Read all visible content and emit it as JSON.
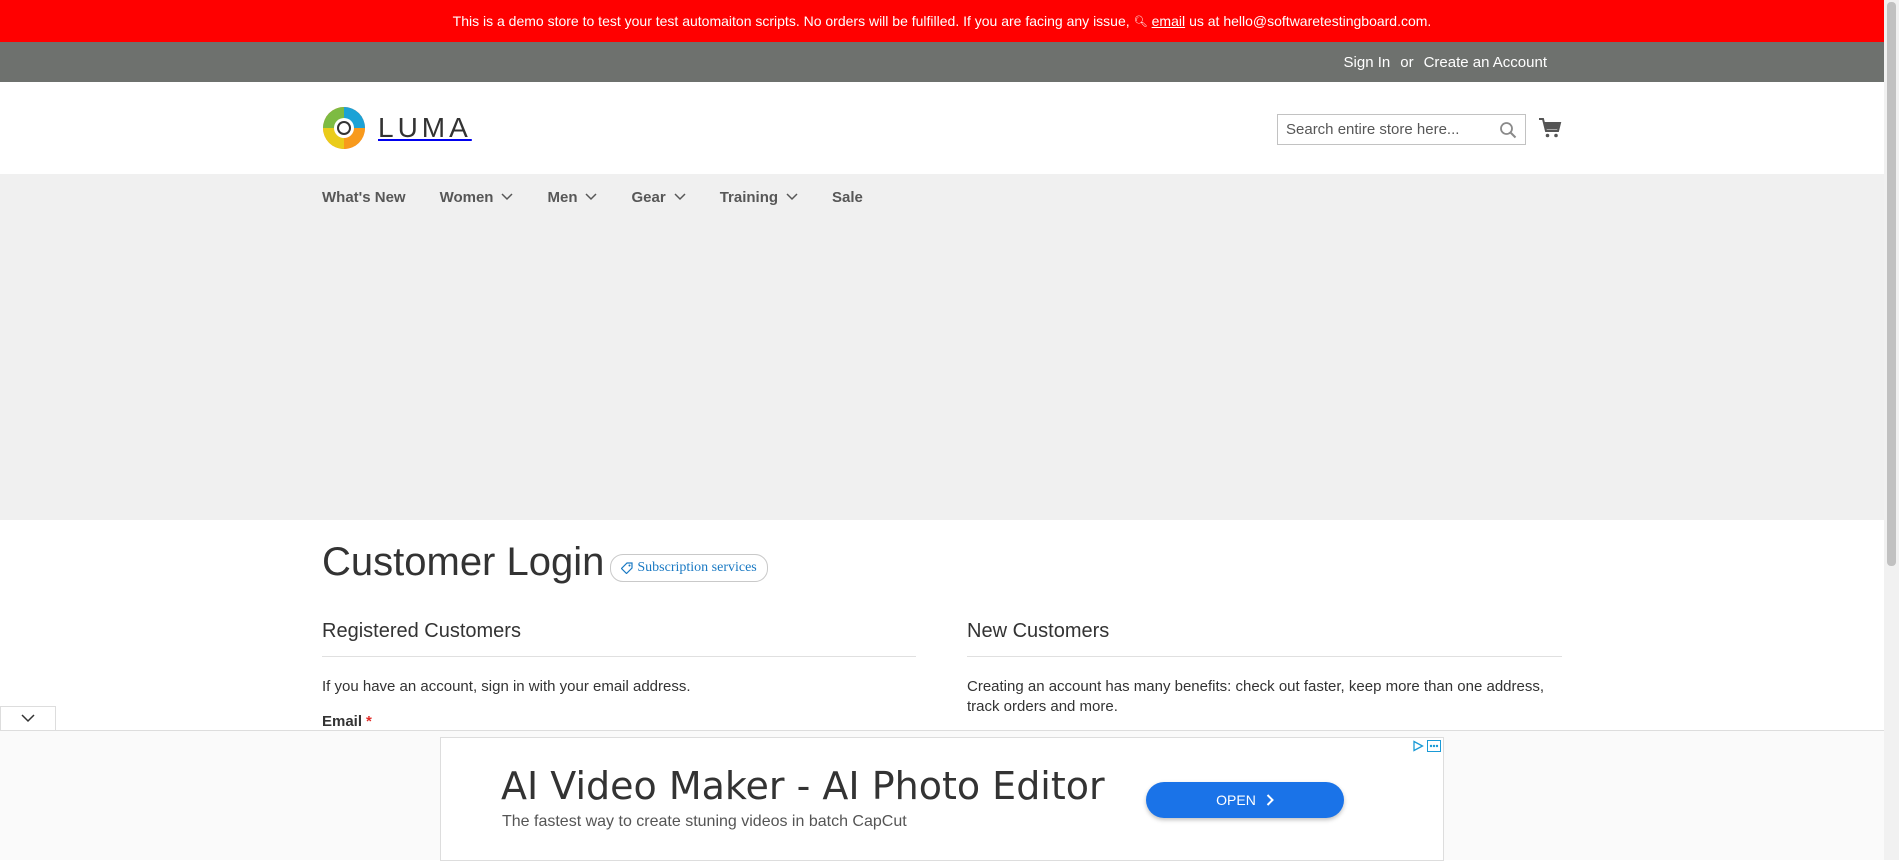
{
  "demo_banner": {
    "text_before": "This is a demo store to test your test automaiton scripts. No orders will be fulfilled. If you are facing any issue,",
    "email_link": "email",
    "text_after": "us at hello@softwaretestingboard.com."
  },
  "top_links": {
    "sign_in": "Sign In",
    "or": "or",
    "create_account": "Create an Account"
  },
  "header": {
    "logo_text": "LUMA",
    "search_placeholder": "Search entire store here..."
  },
  "nav": {
    "items": [
      {
        "label": "What's New",
        "dropdown": false
      },
      {
        "label": "Women",
        "dropdown": true
      },
      {
        "label": "Men",
        "dropdown": true
      },
      {
        "label": "Gear",
        "dropdown": true
      },
      {
        "label": "Training",
        "dropdown": true
      },
      {
        "label": "Sale",
        "dropdown": false
      }
    ]
  },
  "page": {
    "title": "Customer Login",
    "subscription_badge": "Subscription services"
  },
  "registered": {
    "heading": "Registered Customers",
    "text": "If you have an account, sign in with your email address.",
    "email_label": "Email",
    "required_mark": "*"
  },
  "new_customers": {
    "heading": "New Customers",
    "text": "Creating an account has many benefits: check out faster, keep more than one address, track orders and more."
  },
  "ad": {
    "title": "AI Video Maker - AI Photo Editor",
    "subtitle": "The fastest way to create stuning videos in batch CapCut",
    "button": "OPEN"
  },
  "colors": {
    "banner": "#ff0000",
    "top_bar": "#6e716e",
    "nav_bg": "#f0f0f0",
    "link_blue": "#1979c3",
    "ad_button": "#1a73e8"
  }
}
